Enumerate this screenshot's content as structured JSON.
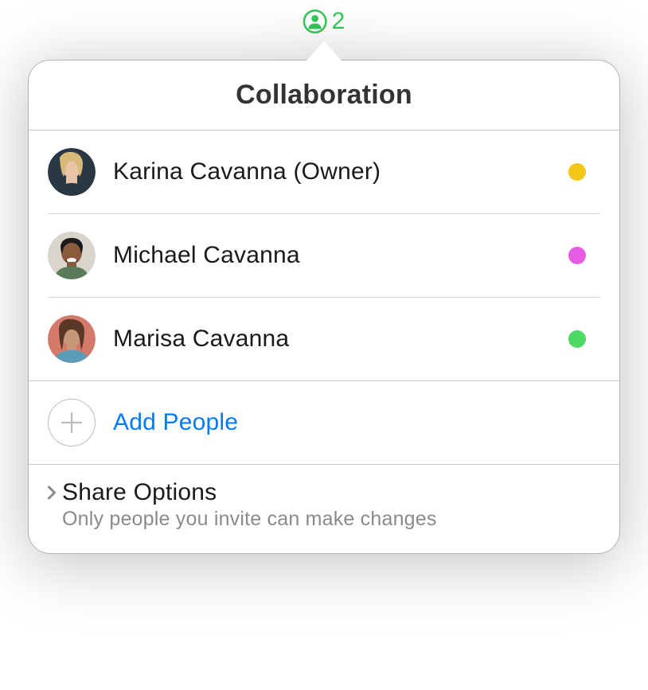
{
  "indicator": {
    "count": "2",
    "color": "#34c759"
  },
  "popover": {
    "title": "Collaboration",
    "people": [
      {
        "name": "Karina Cavanna (Owner)",
        "statusColor": "#f5c518"
      },
      {
        "name": "Michael Cavanna",
        "statusColor": "#e85be5"
      },
      {
        "name": "Marisa Cavanna",
        "statusColor": "#4cd964"
      }
    ],
    "addPeople": {
      "label": "Add People"
    },
    "shareOptions": {
      "title": "Share Options",
      "subtitle": "Only people you invite can make changes"
    }
  }
}
